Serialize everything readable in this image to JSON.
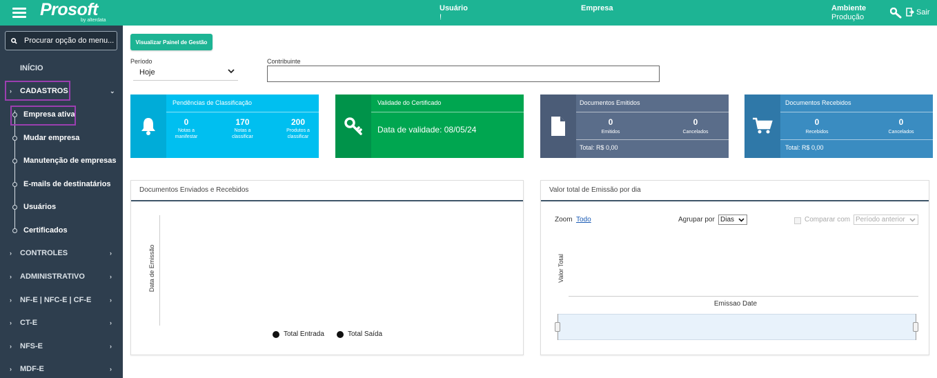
{
  "header": {
    "logo_text": "Prosoft",
    "logo_sub": "by alterdata",
    "user_label": "Usuário",
    "user_value": "!",
    "company_label": "Empresa",
    "env_label": "Ambiente",
    "env_value": "Produção",
    "logout_label": "Sair"
  },
  "sidebar": {
    "search_placeholder": "Procurar opção do menu...",
    "inicio": "INÍCIO",
    "cadastros": "CADASTROS",
    "sub_items": [
      "Empresa ativa",
      "Mudar empresa",
      "Manutenção de empresas",
      "E-mails de destinatários",
      "Usuários",
      "Certificados"
    ],
    "items": [
      "CONTROLES",
      "ADMINISTRATIVO",
      "NF-E | NFC-E | CF-E",
      "CT-E",
      "NFS-E",
      "MDF-E"
    ]
  },
  "main": {
    "panel_button": "Visualizar Painel de Gestão",
    "periodo_label": "Período",
    "periodo_value": "Hoje",
    "contribuinte_label": "Contribuinte",
    "cards": {
      "pend": {
        "title": "Pendências de Classificação",
        "n1": "0",
        "c1": "Notas a manifestar",
        "n2": "170",
        "c2": "Notas a classificar",
        "n3": "200",
        "c3": "Produtos a classificar"
      },
      "cert": {
        "title": "Validade do Certificado",
        "text": "Data de validade: 08/05/24"
      },
      "emit": {
        "title": "Documentos Emitidos",
        "n1": "0",
        "c1": "Emitidos",
        "n2": "0",
        "c2": "Cancelados",
        "total": "Total: R$ 0,00"
      },
      "rec": {
        "title": "Documentos Recebidos",
        "n1": "0",
        "c1": "Recebidos",
        "n2": "0",
        "c2": "Cancelados",
        "total": "Total: R$ 0,00"
      }
    },
    "chart1": {
      "title": "Documentos Enviados e Recebidos",
      "ylabel": "Data de Emissão",
      "legend1": "Total Entrada",
      "legend2": "Total Saída"
    },
    "chart2": {
      "title": "Valor total de Emissão por dia",
      "zoom_label": "Zoom",
      "zoom_link": "Todo",
      "group_label": "Agrupar por",
      "group_value": "Dias",
      "compare_label": "Comparar com",
      "compare_value": "Período anterior",
      "ylabel": "Valor Total",
      "xlabel": "Emissao Date"
    }
  },
  "colors": {
    "brand": "#1db494",
    "sidebar": "#2e3e4e",
    "card_pend": "#00bff0",
    "card_cert": "#00a650",
    "card_emit": "#5a6d8a",
    "card_rec": "#3a8cc1",
    "highlight": "#9b3fb0"
  },
  "chart_data": {
    "type": "line",
    "title": "Valor total de Emissão por dia",
    "xlabel": "Emissao Date",
    "ylabel": "Valor Total",
    "series": []
  }
}
